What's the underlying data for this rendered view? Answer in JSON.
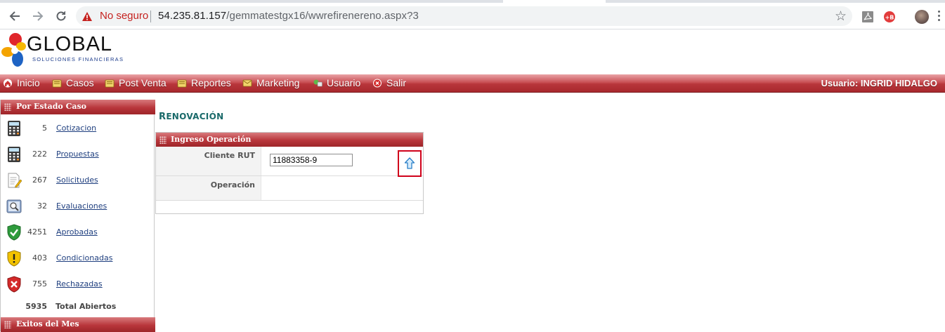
{
  "browser": {
    "security_label": "No seguro",
    "url_host": "54.235.81.157",
    "url_path": "/gemmatestgx16/wwrefirenereno.aspx?3",
    "icons": [
      "back-arrow-icon",
      "forward-arrow-icon",
      "reload-icon",
      "warning-icon",
      "star-icon",
      "pdf-extension-icon",
      "red-extension-icon",
      "profile-avatar",
      "menu-dots-icon"
    ],
    "colors": {
      "warning": "#c5221f",
      "omnibox_bg": "#f1f3f4"
    }
  },
  "header": {
    "logo_word": "GLOBAL",
    "logo_tagline": "SOLUCIONES FINANCIERAS"
  },
  "nav": {
    "items": [
      {
        "label": "Inicio",
        "icon": "home-icon"
      },
      {
        "label": "Casos",
        "icon": "folder-icon"
      },
      {
        "label": "Post Venta",
        "icon": "folder-icon"
      },
      {
        "label": "Reportes",
        "icon": "folder-icon"
      },
      {
        "label": "Marketing",
        "icon": "email-icon"
      },
      {
        "label": "Usuario",
        "icon": "user-icon"
      },
      {
        "label": "Salir",
        "icon": "exit-icon"
      }
    ],
    "user_label": "Usuario:  INGRID HIDALGO",
    "colors": {
      "bar": "#b8363b"
    }
  },
  "sidebar": {
    "title": "Por Estado Caso",
    "items": [
      {
        "count": "5",
        "label": "Cotizacion",
        "icon": "calculator-icon"
      },
      {
        "count": "222",
        "label": "Propuestas",
        "icon": "calculator-icon"
      },
      {
        "count": "267",
        "label": "Solicitudes",
        "icon": "document-pencil-icon"
      },
      {
        "count": "32",
        "label": "Evaluaciones",
        "icon": "magnifier-icon"
      },
      {
        "count": "4251",
        "label": "Aprobadas",
        "icon": "green-shield-check-icon"
      },
      {
        "count": "403",
        "label": "Condicionadas",
        "icon": "yellow-shield-exclamation-icon"
      },
      {
        "count": "755",
        "label": "Rechazadas",
        "icon": "red-shield-x-icon"
      }
    ],
    "total_count": "5935",
    "total_label": "Total Abiertos",
    "second_title": "Exitos del Mes"
  },
  "main": {
    "title_first": "R",
    "title_rest": "ENOVACIÓN",
    "panel_title": "Ingreso Operación",
    "fields": {
      "cliente_rut_label": "Cliente RUT",
      "cliente_rut_value": "11883358-9",
      "operacion_label": "Operación"
    },
    "upload_icon": "up-arrow-icon",
    "colors": {
      "title": "#1a6a6a",
      "highlight_border": "#d0021b"
    }
  }
}
